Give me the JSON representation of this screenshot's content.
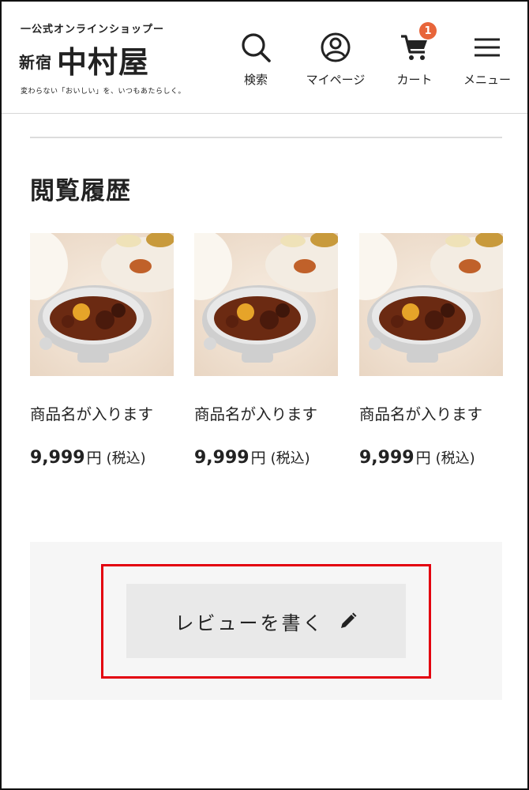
{
  "header": {
    "logo": {
      "tagline_top": "一公式オンラインショップー",
      "name_small": "新宿",
      "name_big": "中村屋",
      "subtitle": "変わらない「おいしい」を、いつもあたらしく。"
    },
    "nav": {
      "search_label": "検索",
      "mypage_label": "マイページ",
      "cart_label": "カート",
      "cart_count": "1",
      "menu_label": "メニュー"
    }
  },
  "history": {
    "title": "閲覧履歴",
    "products": [
      {
        "name": "商品名が入ります",
        "price": "9,999",
        "currency": "円",
        "tax": "(税込)"
      },
      {
        "name": "商品名が入ります",
        "price": "9,999",
        "currency": "円",
        "tax": "(税込)"
      },
      {
        "name": "商品名が入ります",
        "price": "9,999",
        "currency": "円",
        "tax": "(税込)"
      }
    ]
  },
  "review": {
    "button_label": "レビューを書く",
    "icon": "pencil-icon"
  },
  "colors": {
    "badge": "#e8653a",
    "highlight": "#e3000f",
    "button_bg": "#e9e9e9",
    "panel_bg": "#f6f6f6"
  }
}
